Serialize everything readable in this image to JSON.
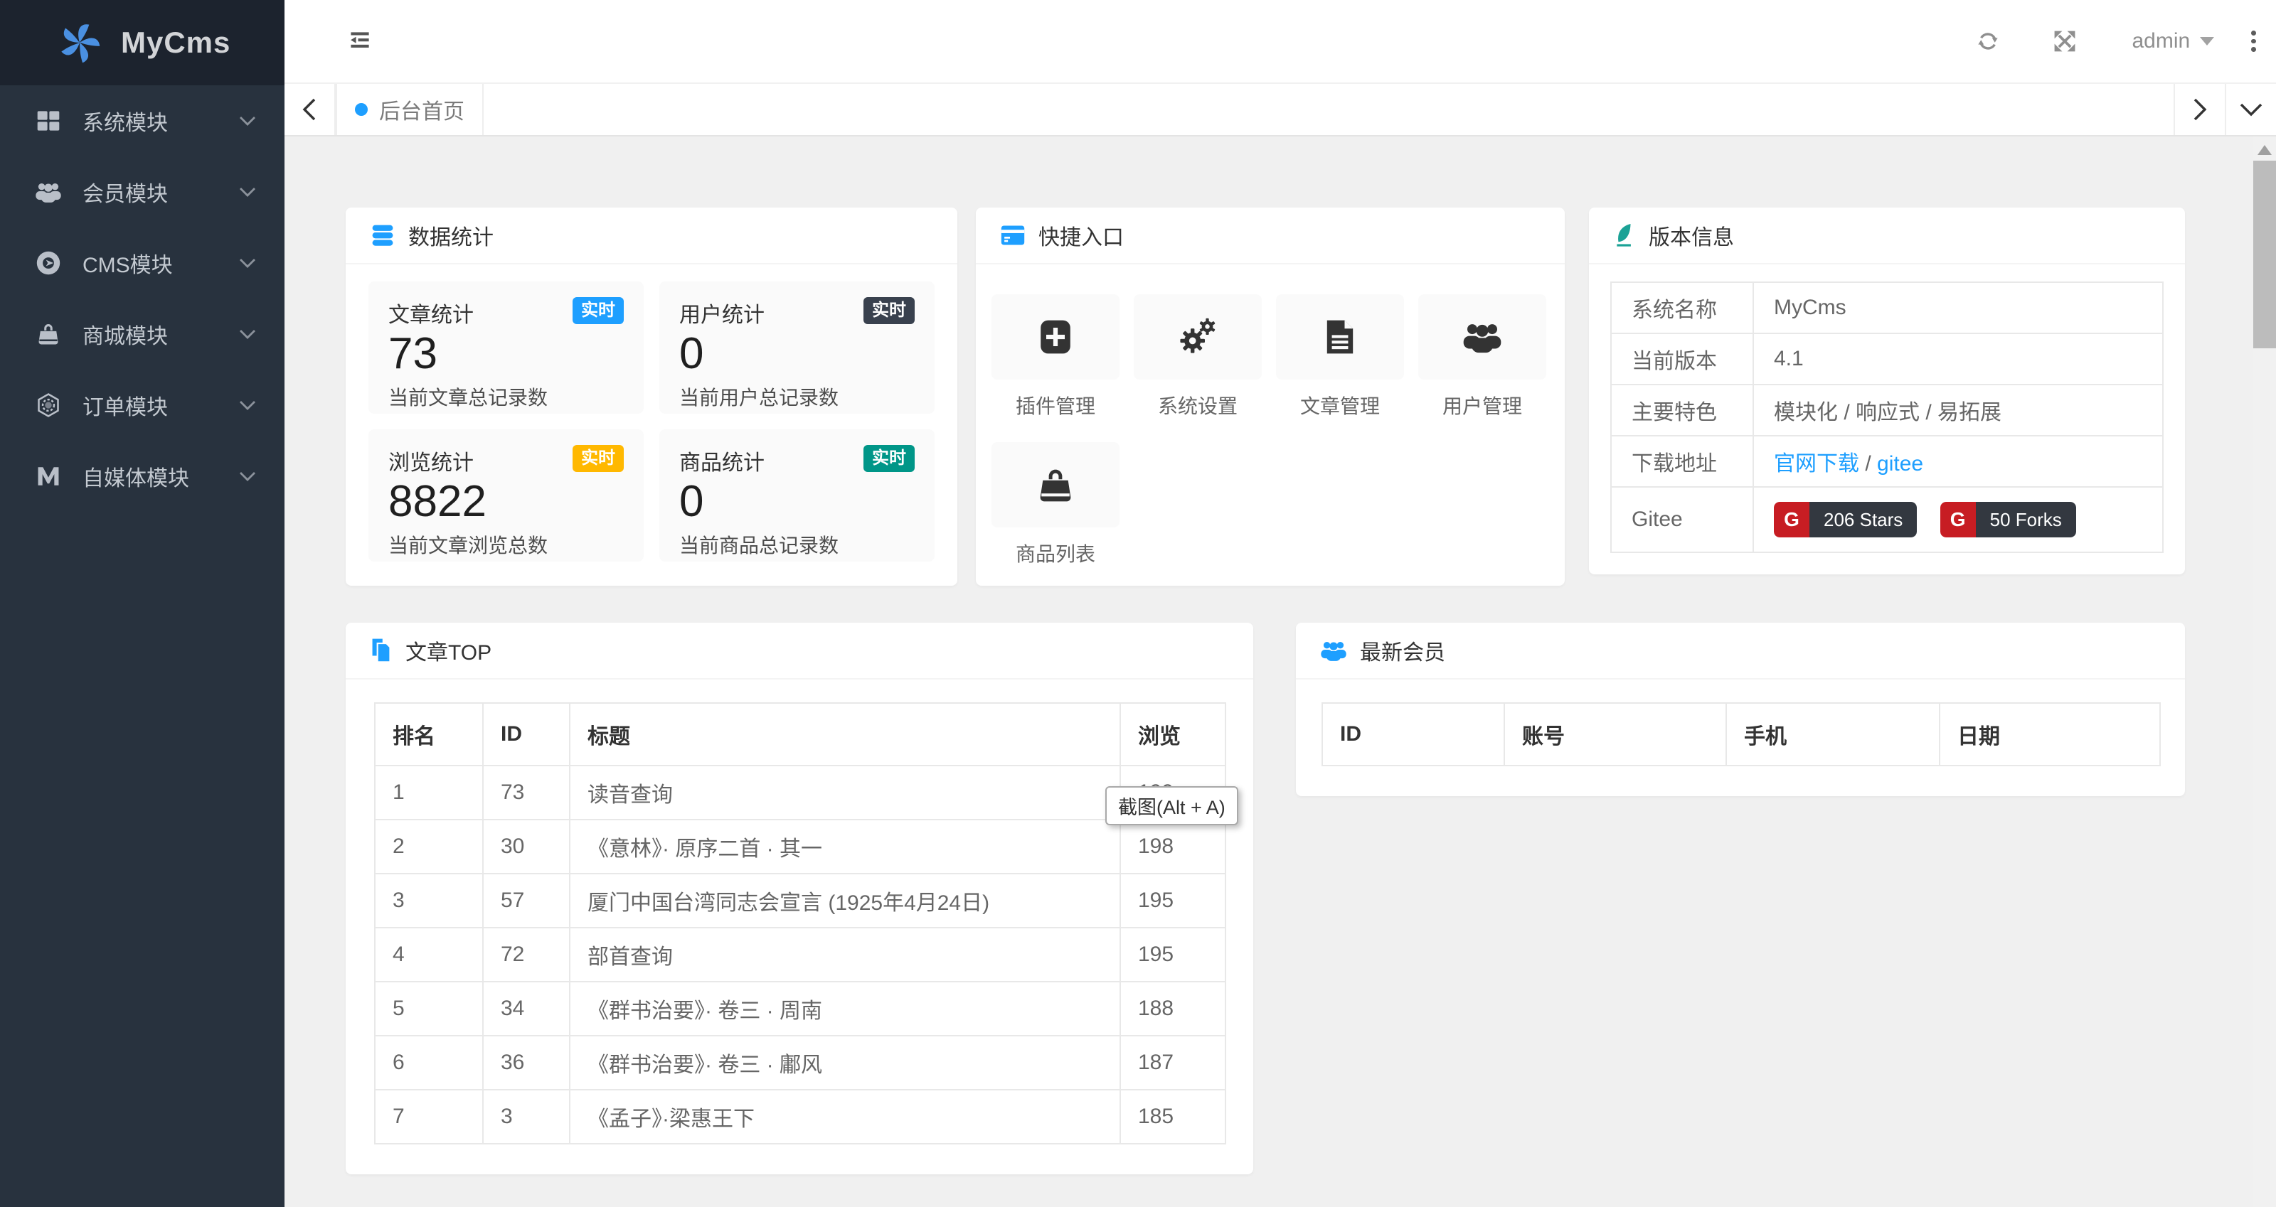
{
  "app": {
    "name": "MyCms"
  },
  "colors": {
    "accent_blue": "#1E9FFF",
    "badge_dark": "#39414e",
    "badge_yellow": "#FFB800",
    "badge_green": "#009688",
    "teal_icon": "#1ba296",
    "sidebar_bg": "#28323e",
    "logo_bg": "#1c232e",
    "gitee_red": "#c71d23",
    "gitee_dark": "#333840"
  },
  "sidebar": {
    "items": [
      {
        "label": "系统模块",
        "icon": "th-large-icon"
      },
      {
        "label": "会员模块",
        "icon": "users-icon"
      },
      {
        "label": "CMS模块",
        "icon": "disc-icon"
      },
      {
        "label": "商城模块",
        "icon": "shopping-bag-icon"
      },
      {
        "label": "订单模块",
        "icon": "hexagon-icon"
      },
      {
        "label": "自媒体模块",
        "icon": "medium-icon"
      }
    ]
  },
  "topbar": {
    "user": "admin"
  },
  "tabs": {
    "active": "后台首页"
  },
  "stats": {
    "title": "数据统计",
    "tiles": [
      {
        "label": "文章统计",
        "badge": "实时",
        "badge_color": "#1E9FFF",
        "value": "73",
        "desc": "当前文章总记录数"
      },
      {
        "label": "用户统计",
        "badge": "实时",
        "badge_color": "#39414e",
        "value": "0",
        "desc": "当前用户总记录数"
      },
      {
        "label": "浏览统计",
        "badge": "实时",
        "badge_color": "#FFB800",
        "value": "8822",
        "desc": "当前文章浏览总数"
      },
      {
        "label": "商品统计",
        "badge": "实时",
        "badge_color": "#009688",
        "value": "0",
        "desc": "当前商品总记录数"
      }
    ]
  },
  "shortcuts": {
    "title": "快捷入口",
    "items": [
      {
        "label": "插件管理",
        "icon": "plus-square-icon"
      },
      {
        "label": "系统设置",
        "icon": "gears-icon"
      },
      {
        "label": "文章管理",
        "icon": "file-text-icon"
      },
      {
        "label": "用户管理",
        "icon": "users-icon"
      },
      {
        "label": "商品列表",
        "icon": "shopping-bag-icon"
      }
    ]
  },
  "version": {
    "title": "版本信息",
    "rows_labels": {
      "name": "系统名称",
      "version": "当前版本",
      "feature": "主要特色",
      "download": "下载地址",
      "gitee": "Gitee"
    },
    "values": {
      "name": "MyCms",
      "version": "4.1",
      "feature": "模块化 / 响应式 / 易拓展"
    },
    "download_links": {
      "official": "官网下载",
      "sep": " / ",
      "gitee": "gitee"
    },
    "badges": [
      {
        "g": "G",
        "label": "206 Stars"
      },
      {
        "g": "G",
        "label": "50 Forks"
      }
    ]
  },
  "articles": {
    "title": "文章TOP",
    "headers": [
      "排名",
      "ID",
      "标题",
      "浏览"
    ],
    "rows": [
      [
        "1",
        "73",
        "读音查询",
        "199"
      ],
      [
        "2",
        "30",
        "《意林》· 原序二首 · 其一",
        "198"
      ],
      [
        "3",
        "57",
        "厦门中国台湾同志会宣言 (1925年4月24日)",
        "195"
      ],
      [
        "4",
        "72",
        "部首查询",
        "195"
      ],
      [
        "5",
        "34",
        "《群书治要》· 卷三 · 周南",
        "188"
      ],
      [
        "6",
        "36",
        "《群书治要》· 卷三 · 鄘风",
        "187"
      ],
      [
        "7",
        "3",
        "《孟子》·梁惠王下",
        "185"
      ]
    ]
  },
  "members": {
    "title": "最新会员",
    "headers": [
      "ID",
      "账号",
      "手机",
      "日期"
    ]
  },
  "tooltip": {
    "text": "截图(Alt + A)"
  }
}
